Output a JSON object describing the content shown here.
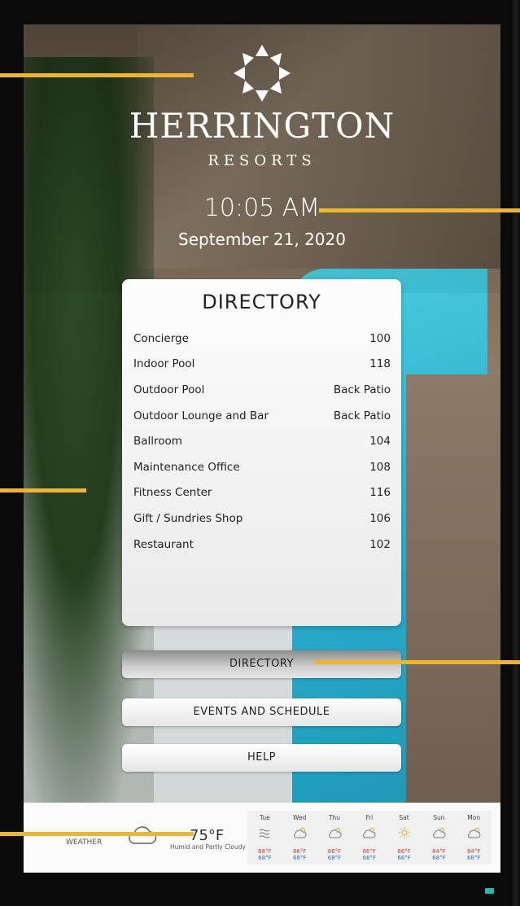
{
  "brand": {
    "name": "HERRINGTON",
    "subtitle": "RESORTS"
  },
  "clock": {
    "time": "10:05 AM",
    "date": "September 21, 2020"
  },
  "directory": {
    "title": "DIRECTORY",
    "entries": [
      {
        "name": "Concierge",
        "location": "100"
      },
      {
        "name": "Indoor Pool",
        "location": "118"
      },
      {
        "name": "Outdoor Pool",
        "location": "Back Patio"
      },
      {
        "name": "Outdoor Lounge and Bar",
        "location": "Back Patio"
      },
      {
        "name": "Ballroom",
        "location": "104"
      },
      {
        "name": "Maintenance Office",
        "location": "108"
      },
      {
        "name": "Fitness Center",
        "location": "116"
      },
      {
        "name": "Gift / Sundries Shop",
        "location": "106"
      },
      {
        "name": "Restaurant",
        "location": "102"
      }
    ]
  },
  "nav": {
    "directory": "DIRECTORY",
    "events": "EVENTS AND SCHEDULE",
    "help": "HELP"
  },
  "weather": {
    "label": "WEATHER",
    "current_temp": "75°F",
    "current_desc": "Humid and Partly Cloudy",
    "current_icon": "cloud-icon",
    "forecast": [
      {
        "day": "Tue",
        "icon": "wind-icon",
        "hi": "88°F",
        "lo": "68°F"
      },
      {
        "day": "Wed",
        "icon": "partly-cloudy-icon",
        "hi": "86°F",
        "lo": "68°F"
      },
      {
        "day": "Thu",
        "icon": "partly-cloudy-icon",
        "hi": "86°F",
        "lo": "68°F"
      },
      {
        "day": "Fri",
        "icon": "partly-cloudy-icon",
        "hi": "86°F",
        "lo": "66°F"
      },
      {
        "day": "Sat",
        "icon": "sun-icon",
        "hi": "86°F",
        "lo": "66°F"
      },
      {
        "day": "Sun",
        "icon": "partly-cloudy-icon",
        "hi": "84°F",
        "lo": "68°F"
      },
      {
        "day": "Mon",
        "icon": "partly-cloudy-icon",
        "hi": "84°F",
        "lo": "68°F"
      }
    ]
  },
  "colors": {
    "callout": "#f0b52e",
    "high_temp": "#d23b2a",
    "low_temp": "#2b6fc6",
    "status_led": "#1fb9b9"
  }
}
